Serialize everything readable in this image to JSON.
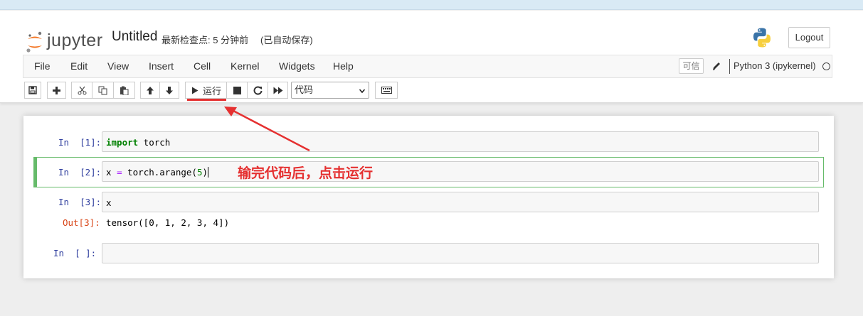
{
  "header": {
    "logo_text": "jupyter",
    "notebook_title": "Untitled",
    "checkpoint": "最新检查点: 5 分钟前",
    "autosave": "(已自动保存)",
    "logout_label": "Logout"
  },
  "menubar": {
    "items": [
      "File",
      "Edit",
      "View",
      "Insert",
      "Cell",
      "Kernel",
      "Widgets",
      "Help"
    ],
    "trusted_label": "可信",
    "kernel_name": "Python 3 (ipykernel)"
  },
  "toolbar": {
    "run_label": "运行",
    "cell_type": "代码",
    "icons": [
      "save-icon",
      "plus-icon",
      "cut-icon",
      "copy-icon",
      "paste-icon",
      "arrow-up-icon",
      "arrow-down-icon",
      "play-icon",
      "stop-icon",
      "restart-icon",
      "fast-forward-icon",
      "keyboard-icon"
    ]
  },
  "cells": [
    {
      "prompt": "In  [1]:",
      "code_kw": "import",
      "code_rest": " torch"
    },
    {
      "prompt": "In  [2]:",
      "code_a": "x ",
      "code_op": "=",
      "code_b": " torch.arange(",
      "code_num": "5",
      "code_c": ")"
    },
    {
      "prompt": "In  [3]:",
      "code": "x",
      "out_prompt": "Out[3]:",
      "output": "tensor([0, 1, 2, 3, 4])"
    },
    {
      "prompt": "In  [ ]:",
      "code": ""
    }
  ],
  "annotation": {
    "text": "输完代码后，点击运行",
    "color": "#e53030"
  },
  "colors": {
    "selected_cell_border": "#66bb6a",
    "prompt_in": "#303f9f",
    "prompt_out": "#d84315",
    "keyword": "#008000"
  }
}
